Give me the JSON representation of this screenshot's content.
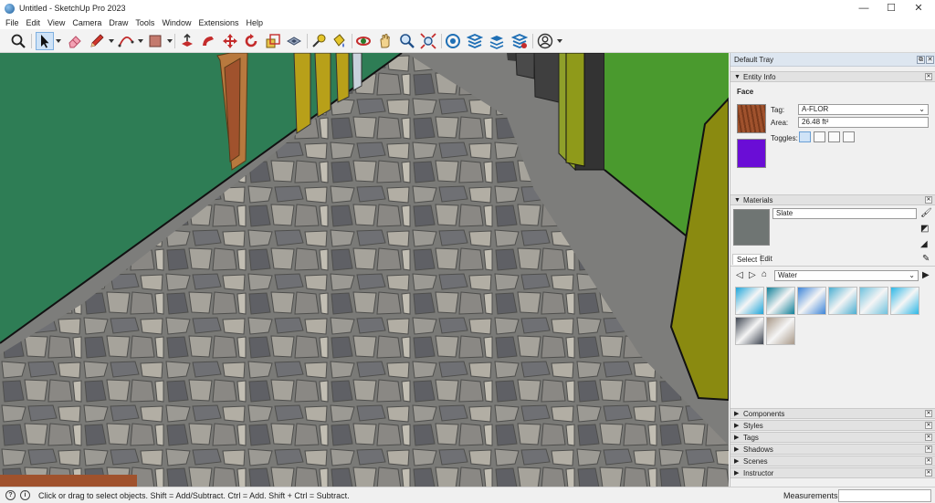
{
  "window": {
    "title": "Untitled - SketchUp Pro 2023",
    "minimize": "—",
    "maximize": "☐",
    "close": "✕"
  },
  "menu": [
    "File",
    "Edit",
    "View",
    "Camera",
    "Draw",
    "Tools",
    "Window",
    "Extensions",
    "Help"
  ],
  "toolbar": {
    "tools": [
      "search-tool",
      "select-tool",
      "eraser-tool",
      "line-tool",
      "arc-tool",
      "rectangle-tool",
      "push-pull-tool",
      "follow-me-tool",
      "move-tool",
      "rotate-tool",
      "scale-tool",
      "offset-tool",
      "tape-measure-tool",
      "paint-bucket-tool",
      "orbit-tool",
      "pan-tool",
      "zoom-tool",
      "zoom-extents-tool",
      "warehouse-tool",
      "extension-warehouse-tool",
      "layout-tool",
      "extension-manager-tool",
      "account-tool"
    ]
  },
  "tray": {
    "title": "Default Tray",
    "entity_info": {
      "header": "Entity Info",
      "type": "Face",
      "tag_label": "Tag:",
      "tag_value": "A-FLOR",
      "area_label": "Area:",
      "area_value": "26.48 ft²",
      "toggles_label": "Toggles:",
      "front_color": "#a0522d",
      "back_color": "#6a0dd6"
    },
    "materials": {
      "header": "Materials",
      "name": "Slate",
      "tab_select": "Select",
      "tab_edit": "Edit",
      "collection": "Water",
      "preview_color": "#6f7573",
      "swatches": [
        "#1ea5d9",
        "#0f7f98",
        "#3c84d8",
        "#4aaed1",
        "#6fc2de",
        "#2cb7e6",
        "#3d4450",
        "#a89888"
      ]
    },
    "collapsed_panels": [
      "Components",
      "Styles",
      "Tags",
      "Shadows",
      "Scenes",
      "Instructor"
    ]
  },
  "status": {
    "hint": "Click or drag to select objects. Shift = Add/Subtract. Ctrl = Add. Shift + Ctrl = Subtract.",
    "measurements_label": "Measurements",
    "help_icon": "?",
    "info_icon": "i"
  },
  "scene": {
    "left_wall_color": "#2e7d55",
    "right_wall_color": "#4a9a2e",
    "floor_color": "#7b7b78",
    "pillar_color": "#3a3a3a",
    "door_frame_color": "#b8a019",
    "door_color": "#a0522d"
  }
}
